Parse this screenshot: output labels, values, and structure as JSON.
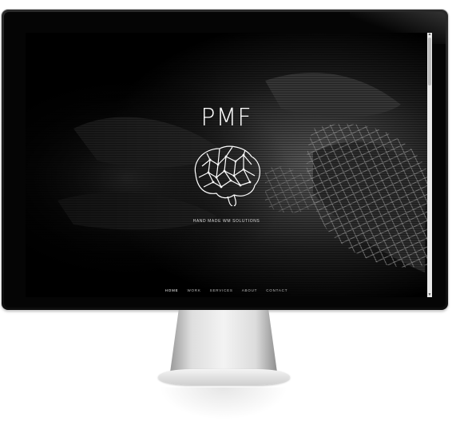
{
  "site": {
    "logo": "PMF",
    "tagline": "HAND MADE WM SOLUTIONS"
  },
  "nav": {
    "items": [
      {
        "label": "HOME",
        "active": true
      },
      {
        "label": "WORK",
        "active": false
      },
      {
        "label": "SERVICES",
        "active": false
      },
      {
        "label": "ABOUT",
        "active": false
      },
      {
        "label": "CONTACT",
        "active": false
      }
    ]
  },
  "icons": {
    "brain": "brain-icon",
    "scroll_up": "chevron-up-icon",
    "scroll_down": "chevron-down-icon"
  },
  "colors": {
    "active_underline": "#2f6bd8",
    "screen_background": "#000000",
    "text": "#ffffff"
  }
}
